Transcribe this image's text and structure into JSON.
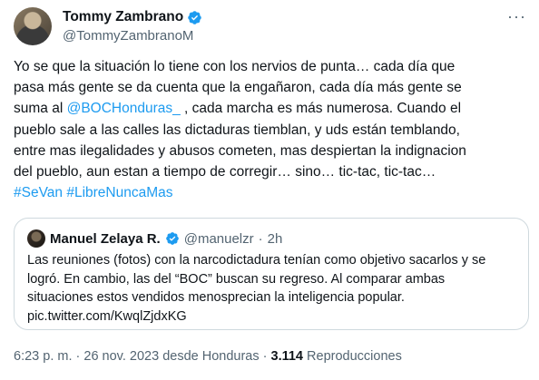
{
  "author": {
    "name": "Tommy Zambrano",
    "handle": "@TommyZambranoM"
  },
  "more_glyph": "···",
  "tweet": {
    "lines": [
      [
        {
          "t": "Yo se que la situación lo tiene con los nervios de punta… cada día que"
        }
      ],
      [
        {
          "t": "pasa más gente se da cuenta que la engañaron, cada día más gente se"
        }
      ],
      [
        {
          "t": "suma al "
        },
        {
          "t": "@BOCHonduras_",
          "link": true
        },
        {
          "t": " , cada marcha es más numerosa. Cuando el"
        }
      ],
      [
        {
          "t": "pueblo sale a las calles las dictaduras tiemblan, y uds están temblando,"
        }
      ],
      [
        {
          "t": "entre mas ilegalidades y abusos cometen, mas despiertan la indignacion"
        }
      ],
      [
        {
          "t": "del pueblo, aun estan a tiempo de corregir… sino… tic-tac, tic-tac…"
        }
      ],
      [
        {
          "t": "#SeVan",
          "link": true
        },
        {
          "t": " "
        },
        {
          "t": "#LibreNuncaMas",
          "link": true
        }
      ]
    ]
  },
  "quote": {
    "name": "Manuel Zelaya R.",
    "handle": "@manuelzr",
    "dot": "·",
    "time": "2h",
    "lines": [
      "Las reuniones (fotos) con la narcodictadura tenían como objetivo sacarlos y se",
      "logró. En cambio, las del “BOC” buscan su regreso. Al comparar ambas",
      "situaciones estos vendidos menosprecian la inteligencia popular.",
      "pic.twitter.com/KwqlZjdxKG"
    ]
  },
  "meta": {
    "time": "6:23 p. m.",
    "sep": "·",
    "date_source": "26 nov. 2023 desde Honduras",
    "views_count": "3.114",
    "views_label": "Reproducciones"
  },
  "colors": {
    "link": "#1d9bf0",
    "verified": "#1d9bf0",
    "muted": "#536471"
  }
}
